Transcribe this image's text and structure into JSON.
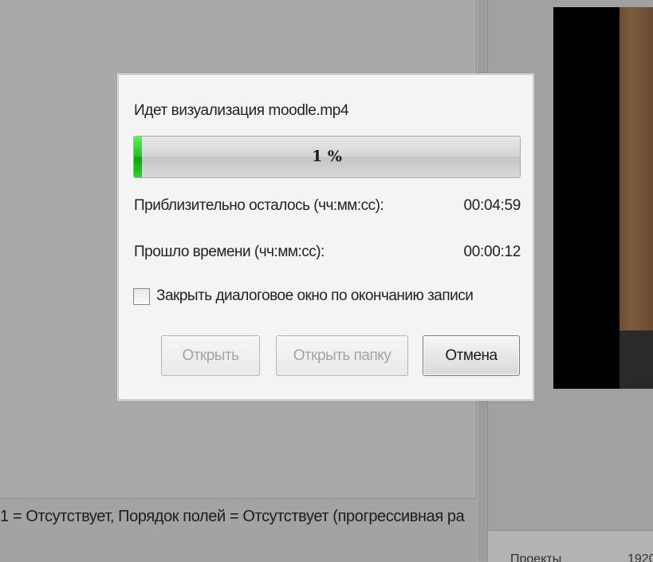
{
  "dialog": {
    "title": "Идет визуализация moodle.mp4",
    "progress": {
      "percent": 1,
      "label": "1 %"
    },
    "remaining": {
      "label": "Приблизительно осталось (чч:мм:сс):",
      "value": "00:04:59"
    },
    "elapsed": {
      "label": "Прошло времени (чч:мм:сс):",
      "value": "00:00:12"
    },
    "close_on_finish": {
      "label": "Закрыть диалоговое окно по окончанию записи",
      "checked": false
    },
    "buttons": {
      "open": "Открыть",
      "open_folder": "Открыть папку",
      "cancel": "Отмена"
    }
  },
  "background": {
    "status_line": "1 = Отсутствует, Порядок полей = Отсутствует (прогрессивная ра",
    "bottom_right_label": "Проекты",
    "bottom_right_value": "1920"
  },
  "colors": {
    "progress_fill": "#1ec21e",
    "dialog_bg": "#f4f4f4",
    "workspace_bg": "#a9a9a9"
  }
}
